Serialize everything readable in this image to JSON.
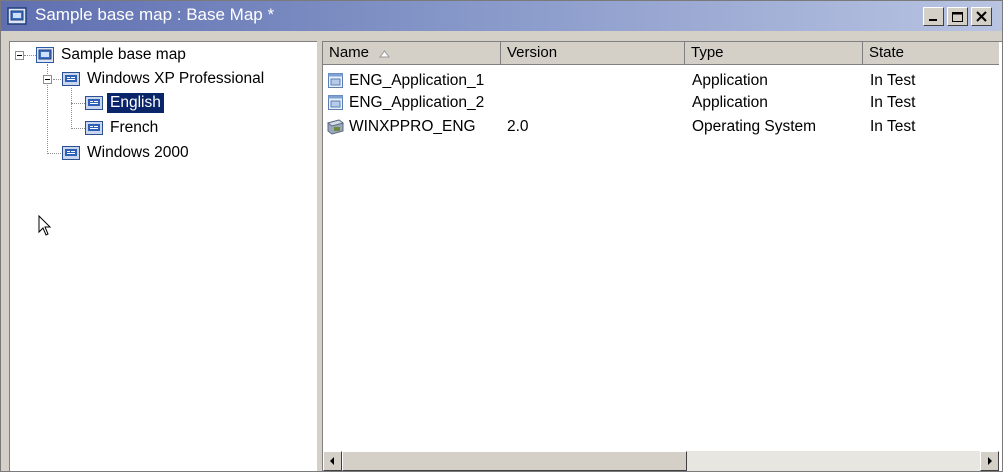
{
  "window": {
    "title": "Sample base map : Base Map *"
  },
  "tree": {
    "items": [
      {
        "label": "Sample base map",
        "icon": "base-map-icon"
      },
      {
        "label": "Windows XP Professional",
        "icon": "os-icon"
      },
      {
        "label": "English",
        "icon": "os-icon",
        "selected": true
      },
      {
        "label": "French",
        "icon": "os-icon"
      },
      {
        "label": "Windows 2000",
        "icon": "os-icon"
      }
    ]
  },
  "list": {
    "columns": [
      "Name",
      "Version",
      "Type",
      "State"
    ],
    "sort": {
      "column": "Name",
      "direction": "ascending"
    },
    "rows": [
      {
        "name": "ENG_Application_1",
        "version": "",
        "type": "Application",
        "state": "In Test",
        "icon": "application-icon"
      },
      {
        "name": "ENG_Application_2",
        "version": "",
        "type": "Application",
        "state": "In Test",
        "icon": "application-icon"
      },
      {
        "name": "WINXPPRO_ENG",
        "version": "2.0",
        "type": "Operating System",
        "state": "In Test",
        "icon": "operating-system-icon"
      }
    ]
  },
  "colors": {
    "titlebar_start": "#5f6fb0",
    "titlebar_end": "#b9c4e2",
    "selection": "#0a246a",
    "chrome": "#d4d0c8"
  }
}
